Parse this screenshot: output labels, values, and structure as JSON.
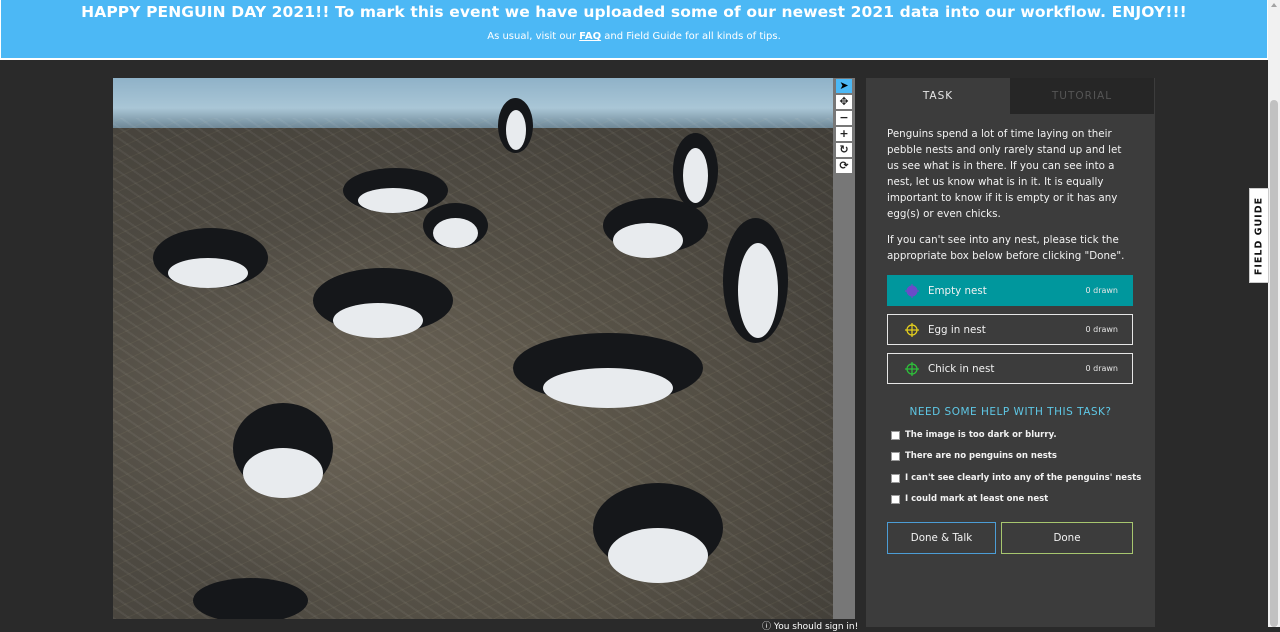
{
  "banner": {
    "headline": "HAPPY PENGUIN DAY 2021!! To mark this event we have uploaded some of our newest 2021 data into our workflow. ENJOY!!!",
    "sub_before": "As usual, visit our ",
    "faq": "FAQ",
    "sub_after": " and Field Guide for all kinds of tips."
  },
  "toolbar": {
    "pointer": "➤",
    "move": "✥",
    "zoom_out": "−",
    "zoom_in": "+",
    "rotate": "↻",
    "reset": "⟳"
  },
  "signin_notice": "You should sign in!",
  "tabs": {
    "task": "TASK",
    "tutorial": "TUTORIAL"
  },
  "instructions": {
    "p1": "Penguins spend a lot of time laying on their pebble nests and only rarely stand up and let us see what is in there. If you can see into a nest, let us know what is in it. It is equally important to know if it is empty or it has any egg(s) or even chicks.",
    "p2": "If you can't see into any nest, please tick the appropriate box below before clicking \"Done\"."
  },
  "tools": [
    {
      "label": "Empty nest",
      "count": "0 drawn",
      "color": "#6a4cc8"
    },
    {
      "label": "Egg in nest",
      "count": "0 drawn",
      "color": "#e8d21c"
    },
    {
      "label": "Chick in nest",
      "count": "0 drawn",
      "color": "#2dc43a"
    }
  ],
  "help": {
    "title": "NEED SOME HELP WITH THIS TASK?",
    "options": [
      "The image is too dark or blurry.",
      "There are no penguins on nests",
      "I can't see clearly into any of the penguins' nests",
      "I could mark at least one nest"
    ]
  },
  "buttons": {
    "done_talk": "Done & Talk",
    "done": "Done"
  },
  "field_guide": "FIELD GUIDE"
}
